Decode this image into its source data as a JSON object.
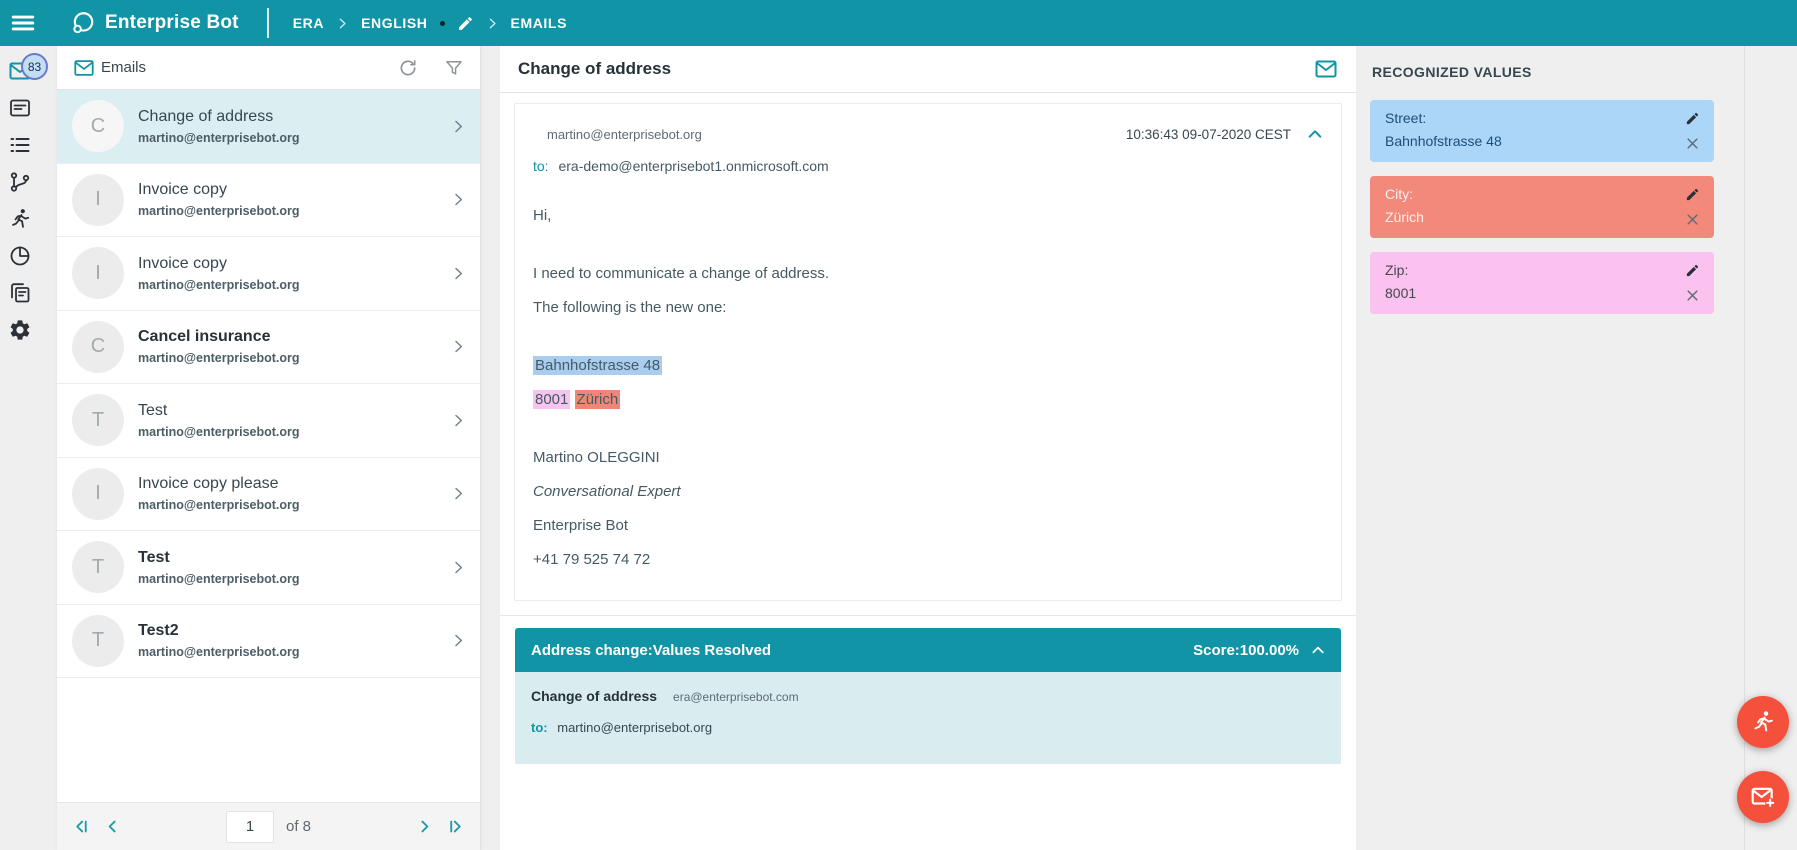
{
  "colors": {
    "teal": "#1195A6",
    "page_bg": "#EFEFEF",
    "selected_row": "#DBEEF2",
    "resolved_bg": "#D9EDF1",
    "hl_street": "#A9CDEF",
    "hl_zip": "#F7C3EF",
    "hl_city": "#EF8678",
    "fab": "#F4503C",
    "badge_bg": "#C3DDF4",
    "badge_border": "#6A79C9"
  },
  "topbar": {
    "brand": "Enterprise Bot",
    "logo_icon": "logo-ring-icon",
    "menu_icon": "hamburger-icon",
    "breadcrumb": [
      {
        "label": "ERA",
        "editable": false
      },
      {
        "label": "ENGLISH",
        "editable": true
      },
      {
        "label": "EMAILS",
        "editable": false
      }
    ]
  },
  "rail": {
    "items": [
      {
        "icon": "envelope-icon",
        "name": "emails",
        "active": true,
        "badge": "83"
      },
      {
        "icon": "note-card-icon",
        "name": "responses",
        "active": false
      },
      {
        "icon": "list-icon",
        "name": "entities",
        "active": false
      },
      {
        "icon": "branch-icon",
        "name": "flows",
        "active": false
      },
      {
        "icon": "runner-icon",
        "name": "training",
        "active": false
      },
      {
        "icon": "pie-chart-icon",
        "name": "analytics",
        "active": false
      },
      {
        "icon": "documents-icon",
        "name": "templates",
        "active": false
      },
      {
        "icon": "gear-icon",
        "name": "settings",
        "active": false
      }
    ]
  },
  "email_list": {
    "title": "Emails",
    "title_icon": "envelope-icon",
    "actions": [
      {
        "icon": "refresh-icon",
        "name": "refresh"
      },
      {
        "icon": "filter-icon",
        "name": "filter"
      }
    ],
    "items": [
      {
        "initial": "C",
        "title": "Change of address",
        "email": "martino@enterprisebot.org",
        "selected": true,
        "unread": false
      },
      {
        "initial": "I",
        "title": "Invoice copy",
        "email": "martino@enterprisebot.org",
        "selected": false,
        "unread": false
      },
      {
        "initial": "I",
        "title": "Invoice copy",
        "email": "martino@enterprisebot.org",
        "selected": false,
        "unread": false
      },
      {
        "initial": "C",
        "title": "Cancel insurance",
        "email": "martino@enterprisebot.org",
        "selected": false,
        "unread": true
      },
      {
        "initial": "T",
        "title": "Test",
        "email": "martino@enterprisebot.org",
        "selected": false,
        "unread": false
      },
      {
        "initial": "I",
        "title": "Invoice copy please",
        "email": "martino@enterprisebot.org",
        "selected": false,
        "unread": false
      },
      {
        "initial": "T",
        "title": "Test",
        "email": "martino@enterprisebot.org",
        "selected": false,
        "unread": true
      },
      {
        "initial": "T",
        "title": "Test2",
        "email": "martino@enterprisebot.org",
        "selected": false,
        "unread": true
      }
    ],
    "pagination": {
      "page": "1",
      "of_label": "of 8",
      "icons": [
        "page-first-icon",
        "page-prev-icon",
        "page-next-icon",
        "page-last-icon"
      ]
    }
  },
  "detail": {
    "title": "Change of address",
    "header_icon": "envelope-icon",
    "from": "martino@enterprisebot.org",
    "timestamp": "10:36:43 09-07-2020 CEST",
    "collapse_icon": "chevron-up-icon",
    "to_label": "to:",
    "to": "era-demo@enterprisebot1.onmicrosoft.com",
    "body": [
      [
        {
          "text": "Hi,"
        }
      ],
      [],
      [
        {
          "text": "I need to communicate a change of address."
        }
      ],
      [
        {
          "text": "The following is the new one:"
        }
      ],
      [],
      [
        {
          "text": "Bahnhofstrasse 48",
          "highlight": "street"
        }
      ],
      [
        {
          "text": "8001",
          "highlight": "zip"
        },
        {
          "text": " "
        },
        {
          "text": "Zürich",
          "highlight": "city"
        }
      ],
      [],
      [
        {
          "text": "Martino OLEGGINI"
        }
      ],
      [
        {
          "text": "Conversational Expert",
          "italic": true
        }
      ],
      [
        {
          "text": "Enterprise Bot"
        }
      ],
      [
        {
          "text": "+41 79 525 74 72"
        }
      ]
    ],
    "banner": {
      "title": "Address change:Values Resolved",
      "score": "Score:100.00%",
      "collapse_icon": "chevron-up-icon"
    },
    "resolved": {
      "subject": "Change of address",
      "from": "era@enterprisebot.com",
      "to_label": "to:",
      "to": "martino@enterprisebot.org"
    }
  },
  "recognized": {
    "title": "RECOGNIZED VALUES",
    "card_actions": [
      "pencil-icon",
      "close-icon"
    ],
    "cards": [
      {
        "label": "Street:",
        "value": "Bahnhofstrasse 48",
        "bg": "#ABD6F8",
        "fg": "#1D4E79"
      },
      {
        "label": "City:",
        "value": "Zürich",
        "bg": "#F2897B",
        "fg": "#FFF0ED"
      },
      {
        "label": "Zip:",
        "value": "8001",
        "bg": "#FBC2EF",
        "fg": "#43454F"
      }
    ]
  },
  "fabs": [
    {
      "icon": "runner-icon",
      "name": "training-fab"
    },
    {
      "icon": "envelope-plus-icon",
      "name": "compose-email-fab"
    }
  ]
}
